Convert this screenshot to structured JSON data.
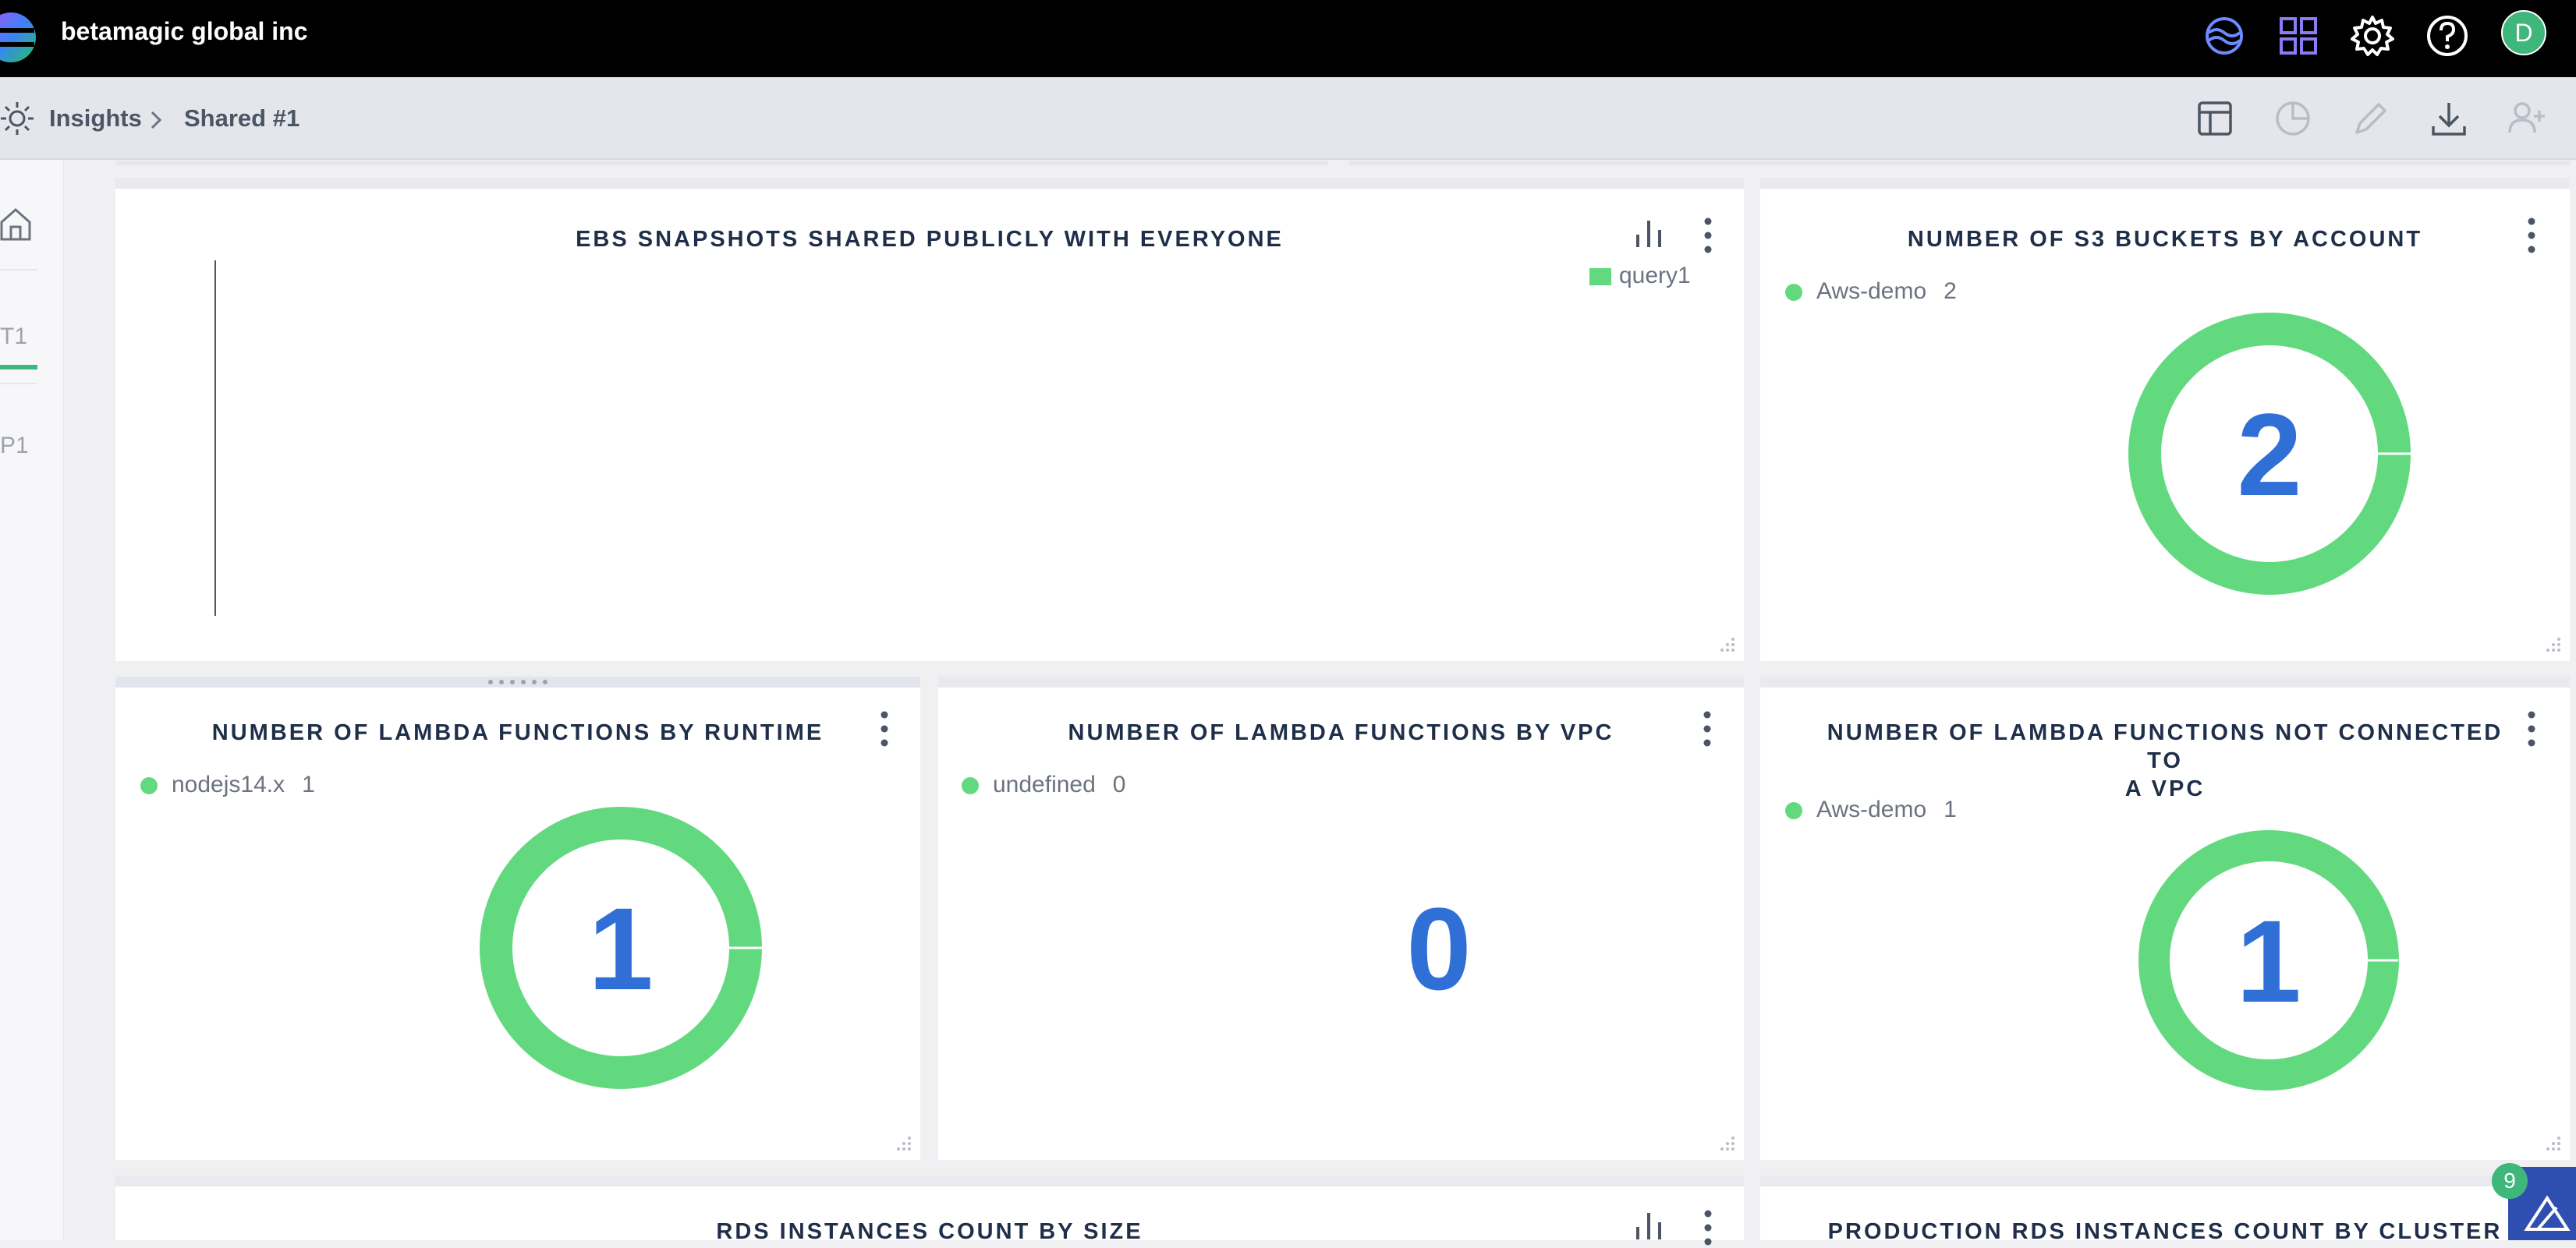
{
  "header": {
    "org_name": "betamagic global inc",
    "avatar_letter": "D",
    "colors": {
      "bar": "#000000",
      "accent": "#63d97f",
      "number": "#2f6fd6"
    }
  },
  "breadcrumb": {
    "root": "Insights",
    "current": "Shared #1"
  },
  "left_rail": {
    "tab_t1": "T1",
    "tab_p1": "P1"
  },
  "panels": {
    "ebs": {
      "title": "EBS SNAPSHOTS SHARED PUBLICLY WITH EVERYONE",
      "legend": "query1"
    },
    "s3": {
      "title": "NUMBER OF S3 BUCKETS BY ACCOUNT",
      "legend_label": "Aws-demo",
      "legend_value": "2",
      "value": "2"
    },
    "lambda_runtime": {
      "title": "NUMBER OF LAMBDA FUNCTIONS BY RUNTIME",
      "legend_label": "nodejs14.x",
      "legend_value": "1",
      "value": "1"
    },
    "lambda_vpc": {
      "title": "NUMBER OF LAMBDA FUNCTIONS BY VPC",
      "legend_label": "undefined",
      "legend_value": "0",
      "value": "0"
    },
    "lambda_no_vpc": {
      "title_line1": "NUMBER OF LAMBDA FUNCTIONS NOT CONNECTED TO",
      "title_line2": "A VPC",
      "legend_label": "Aws-demo",
      "legend_value": "1",
      "value": "1"
    },
    "rds_size": {
      "title": "RDS INSTANCES COUNT BY SIZE"
    },
    "rds_cluster": {
      "title": "PRODUCTION RDS INSTANCES COUNT BY CLUSTER"
    }
  },
  "notification": {
    "count": "9"
  }
}
